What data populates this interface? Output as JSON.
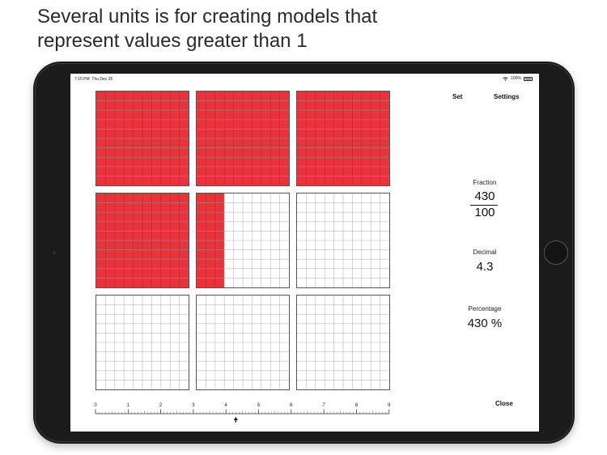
{
  "headline": {
    "line1": "Several units is for creating models that",
    "line2": "represent values greater than 1"
  },
  "statusbar": {
    "time": "7:10 PM",
    "date": "Thu Dec 26",
    "battery": "100%"
  },
  "toolbar": {
    "set_label": "Set",
    "settings_label": "Settings"
  },
  "model": {
    "units_shown": 9,
    "grid_divisions": 10,
    "fill_color": "#e8323c",
    "grid_line_color": "#b9b9b9",
    "unit_fills": [
      1,
      1,
      1,
      1,
      0.3,
      0,
      0,
      0,
      0
    ]
  },
  "panel": {
    "fraction_label": "Fraction",
    "numerator": "430",
    "denominator": "100",
    "decimal_label": "Decimal",
    "decimal_value": "4.3",
    "percentage_label": "Percentage",
    "percentage_value": "430 %"
  },
  "number_line": {
    "tick_labels": [
      "0",
      "1",
      "2",
      "3",
      "4",
      "5",
      "6",
      "7",
      "8",
      "9"
    ],
    "marker_value": 4.3
  },
  "close_label": "Close",
  "icons": {
    "wifi": "wifi-icon",
    "battery": "battery-icon",
    "marker": "arrow-up-icon"
  }
}
